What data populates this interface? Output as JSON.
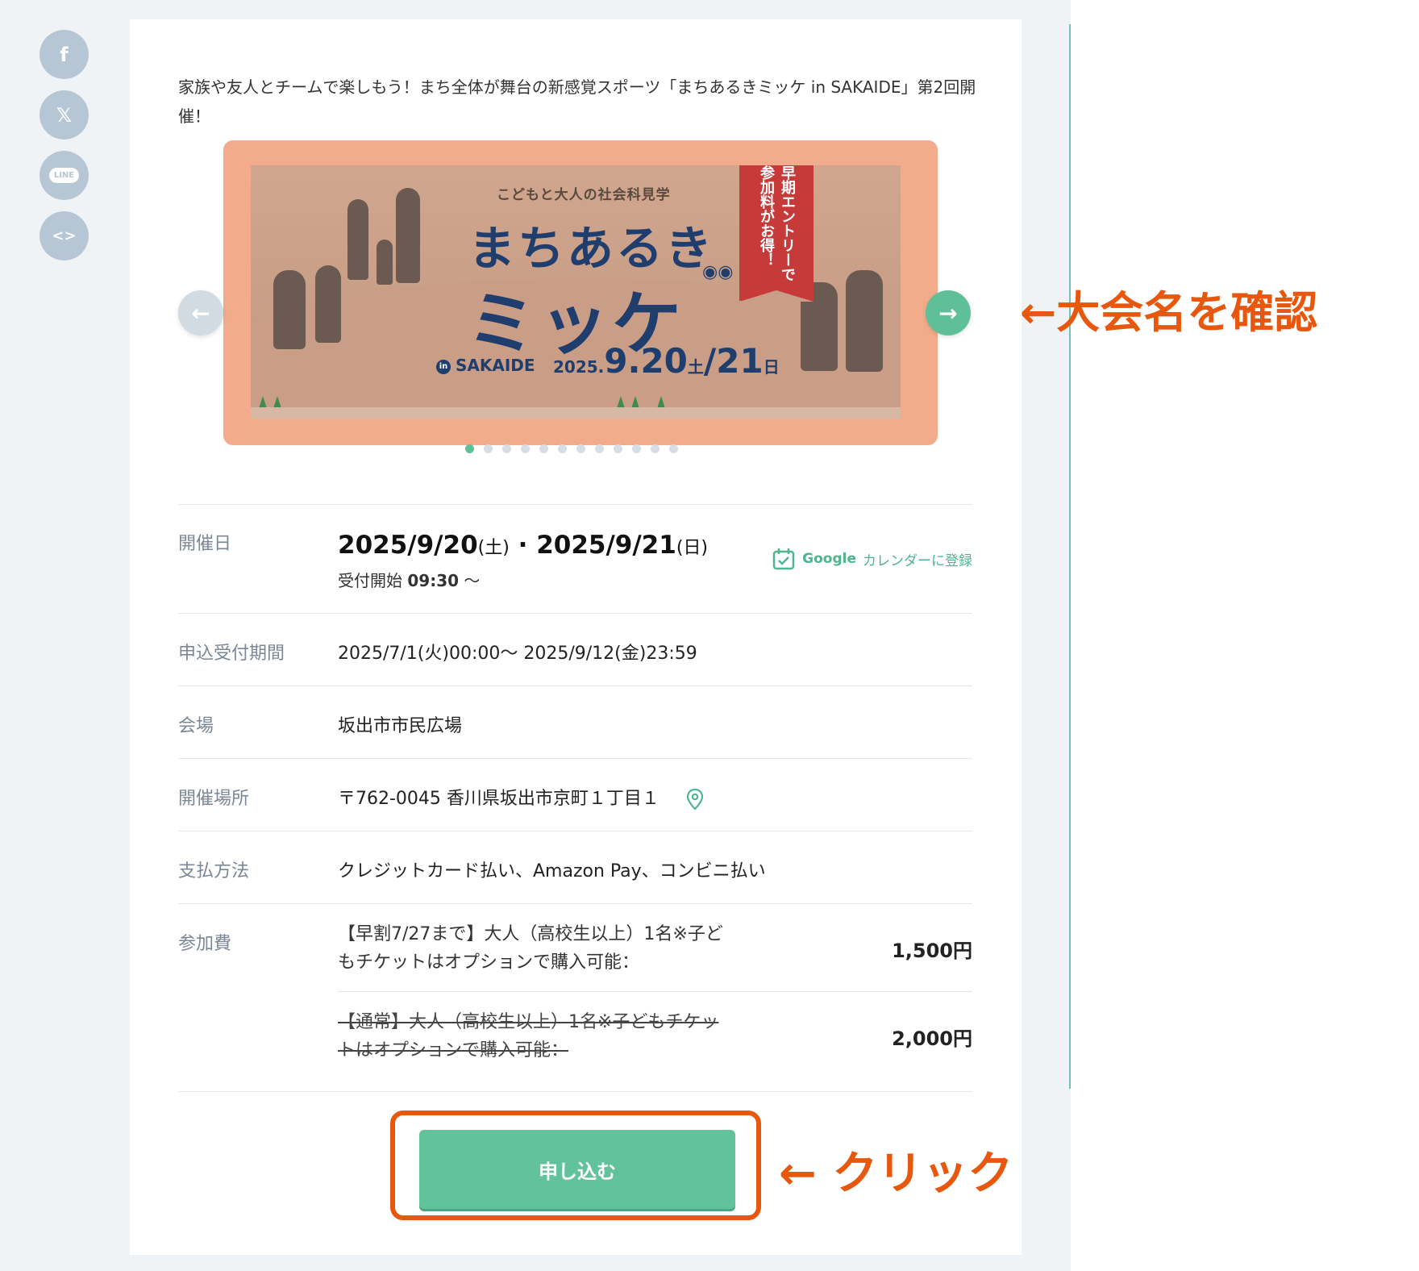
{
  "share": {
    "facebook": "f",
    "x": "𝕏",
    "line": "LINE",
    "embed": "<>"
  },
  "intro": "家族や友人とチームで楽しもう！まち全体が舞台の新感覚スポーツ「まちあるきミッケ in SAKAIDE」第2回開催！",
  "banner": {
    "subtitle": "こどもと大人の社会科見学",
    "title_line1": "まちあるき",
    "title_line2": "ミッケ",
    "location_in": "in",
    "location": "SAKAIDE",
    "date_year": "2025.",
    "date_main": "9.20",
    "date_day1": "土",
    "date_slash": "/21",
    "date_day2": "日",
    "ribbon": "早期エントリーで参加料がお得！"
  },
  "carousel": {
    "prev": "←",
    "next": "→",
    "dot_count": 12,
    "active_index": 0
  },
  "details": {
    "date_label": "開催日",
    "date_value1": "2025/9/20",
    "date_day1": "(土)",
    "date_sep": " · ",
    "date_value2": "2025/9/21",
    "date_day2": "(日)",
    "reception_label": "受付開始",
    "reception_time": "09:30",
    "reception_suffix": "〜",
    "gcal_brand": "Google",
    "gcal_text": "カレンダーに登録",
    "period_label": "申込受付期間",
    "period_value": "2025/7/1(火)00:00〜 2025/9/12(金)23:59",
    "venue_label": "会場",
    "venue_value": "坂出市市民広場",
    "place_label": "開催場所",
    "place_value": "〒762-0045 香川県坂出市京町１丁目１",
    "payment_label": "支払方法",
    "payment_value": "クレジットカード払い、Amazon Pay、コンビニ払い",
    "fee_label": "参加費",
    "fees": [
      {
        "desc": "【早割7/27まで】大人（高校生以上）1名※子どもチケットはオプションで購入可能：",
        "price": "1,500円"
      },
      {
        "desc": "【通常】大人（高校生以上）1名※子どもチケットはオプションで購入可能：",
        "price": "2,000円"
      }
    ]
  },
  "apply_label": "申し込む",
  "annotations": {
    "name_check": "←大会名を確認",
    "click": "← クリック"
  },
  "colors": {
    "accent": "#5fbf98",
    "annotation": "#e8570e",
    "banner_frame": "#f2ac8b",
    "title_navy": "#1f3e6d"
  }
}
